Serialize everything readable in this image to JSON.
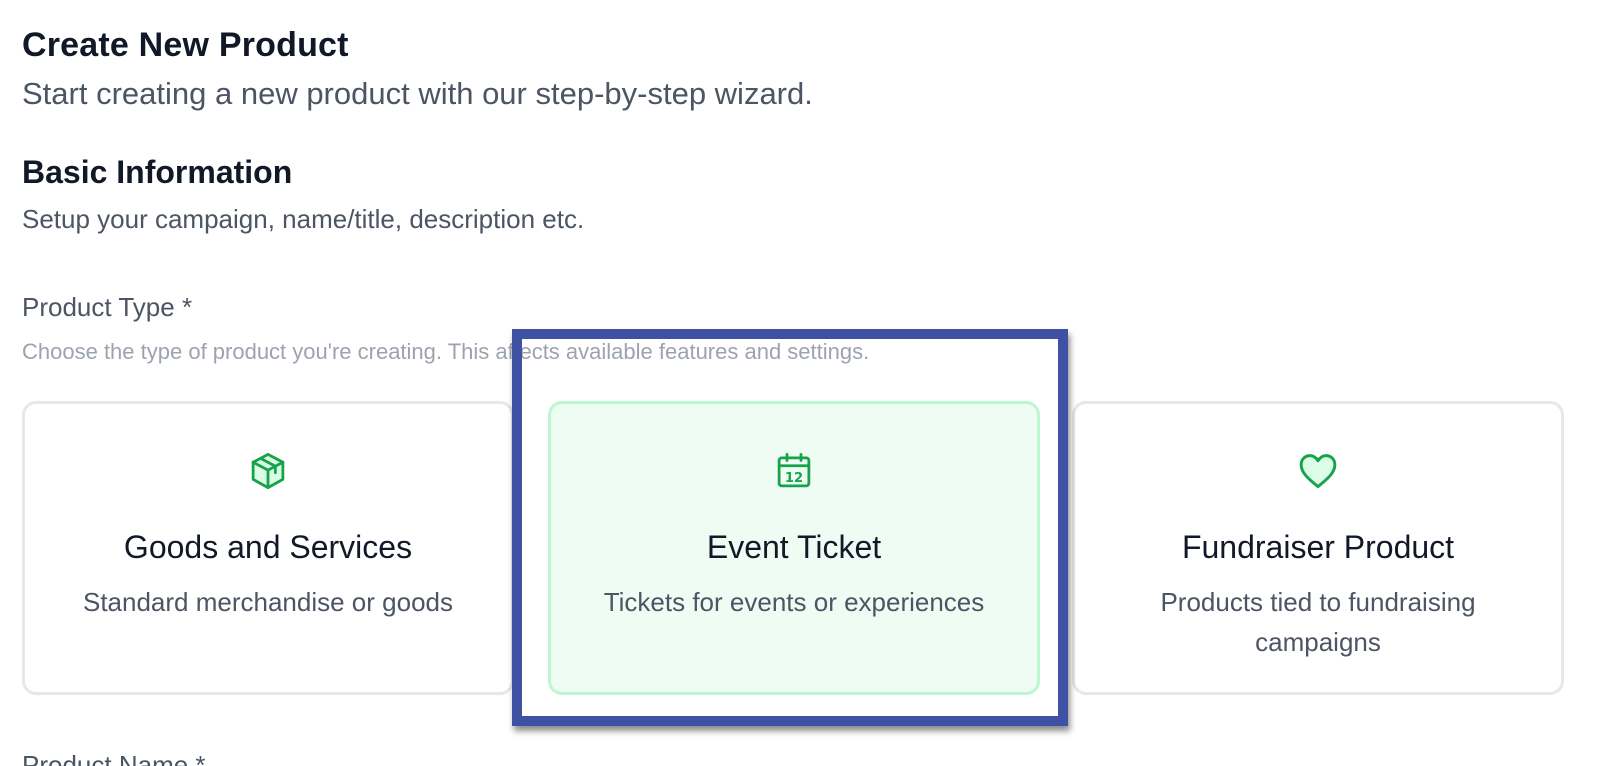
{
  "header": {
    "title": "Create New Product",
    "subtitle": "Start creating a new product with our step-by-step wizard."
  },
  "section": {
    "title": "Basic Information",
    "description": "Setup your campaign, name/title, description etc."
  },
  "product_type": {
    "label": "Product Type *",
    "hint": "Choose the type of product you're creating. This affects available features and settings.",
    "options": [
      {
        "title": "Goods and Services",
        "description": "Standard merchandise or goods",
        "icon": "package-icon",
        "selected": false
      },
      {
        "title": "Event Ticket",
        "description": "Tickets for events or experiences",
        "icon": "calendar-icon",
        "selected": true
      },
      {
        "title": "Fundraiser Product",
        "description": "Products tied to fundraising campaigns",
        "icon": "heart-icon",
        "selected": false
      }
    ]
  },
  "product_name": {
    "label": "Product Name *"
  },
  "colors": {
    "accent": "#16a34a",
    "selected_bg": "#effcf3",
    "selected_border": "#bbf7d0",
    "highlight": "#3f51a2"
  }
}
